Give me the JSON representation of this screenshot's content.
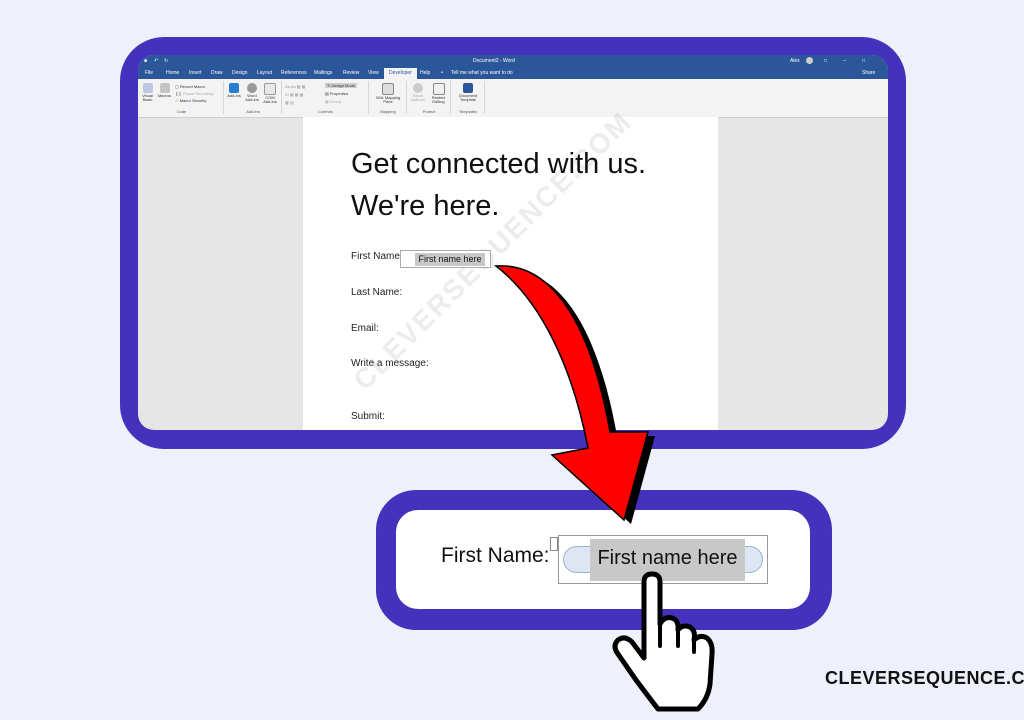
{
  "titlebar": {
    "doc_title": "Document2 - Word",
    "user": "Alex",
    "share": "Share"
  },
  "tabs": [
    "File",
    "Home",
    "Insert",
    "Draw",
    "Design",
    "Layout",
    "References",
    "Mailings",
    "Review",
    "View",
    "Developer",
    "Help"
  ],
  "tell_me": "Tell me what you want to do",
  "ribbon": {
    "code": {
      "visual_basic": "Visual Basic",
      "macros": "Macros",
      "record_macro": "Record Macro",
      "pause_recording": "Pause Recording",
      "macro_security": "Macro Security",
      "label": "Code"
    },
    "addins": {
      "add_ins": "Add-ins",
      "word_add_ins": "Word Add-ins",
      "com_add_ins": "COM Add-ins",
      "label": "Add-ins"
    },
    "controls": {
      "design_mode": "Design Mode",
      "properties": "Properties",
      "group": "Group",
      "label": "Controls"
    },
    "mapping": {
      "xml_mapping_pane": "XML Mapping Pane",
      "label": "Mapping"
    },
    "protect": {
      "block_authors": "Block Authors",
      "restrict_editing": "Restrict Editing",
      "label": "Protect"
    },
    "templates": {
      "document_template": "Document Template",
      "label": "Templates"
    }
  },
  "document": {
    "heading": "Get connected with us. We're here.",
    "watermark": "CLEVERSEQUENCE.COM",
    "fields": {
      "first_name": "First Name:",
      "last_name": "Last Name:",
      "email": "Email:",
      "message": "Write a message:",
      "submit": "Submit:"
    },
    "first_name_placeholder": "First name here"
  },
  "callout": {
    "label": "First Name:",
    "placeholder": "First name here"
  },
  "brand": "CLEVERSEQUENCE.COM",
  "colors": {
    "frame": "#4432bd",
    "word_blue": "#2b579a",
    "arrow": "#ff0000",
    "background": "#eef0fb"
  }
}
